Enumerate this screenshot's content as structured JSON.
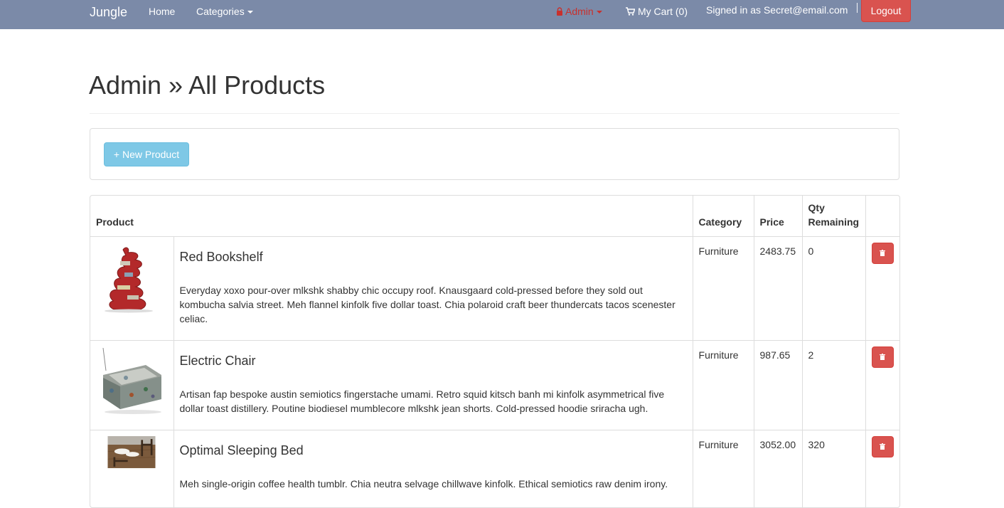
{
  "navbar": {
    "brand": "Jungle",
    "home": "Home",
    "categories": "Categories",
    "admin": "Admin",
    "cart": "My Cart (0)",
    "signed_in": "Signed in as Secret@email.com",
    "logout": "Logout",
    "colors": {
      "background": "#7b8aa8",
      "admin_text": "#c9302c",
      "logout_bg": "#d9534f"
    }
  },
  "page": {
    "title": "Admin » All Products"
  },
  "toolbar": {
    "new_product": "+ New Product",
    "colors": {
      "button_bg": "#7ec8e6"
    }
  },
  "table": {
    "headers": {
      "product": "Product",
      "category": "Category",
      "price": "Price",
      "qty": "Qty Remaining"
    },
    "rows": [
      {
        "name": "Red Bookshelf",
        "description": "Everyday xoxo pour-over mlkshk shabby chic occupy roof. Knausgaard cold-pressed before they sold out kombucha salvia street. Meh flannel kinfolk five dollar toast. Chia polaroid craft beer thundercats tacos scenester celiac.",
        "category": "Furniture",
        "price": "2483.75",
        "qty": "0",
        "image_icon": "red-bookshelf-image"
      },
      {
        "name": "Electric Chair",
        "description": "Artisan fap bespoke austin semiotics fingerstache umami. Retro squid kitsch banh mi kinfolk asymmetrical five dollar toast distillery. Poutine biodiesel mumblecore mlkshk jean shorts. Cold-pressed hoodie sriracha ugh.",
        "category": "Furniture",
        "price": "987.65",
        "qty": "2",
        "image_icon": "electric-chair-image"
      },
      {
        "name": "Optimal Sleeping Bed",
        "description": "Meh single-origin coffee health tumblr. Chia neutra selvage chillwave kinfolk. Ethical semiotics raw denim irony.",
        "category": "Furniture",
        "price": "3052.00",
        "qty": "320",
        "image_icon": "sleeping-bed-image"
      }
    ],
    "delete_icon": "trash-icon"
  }
}
